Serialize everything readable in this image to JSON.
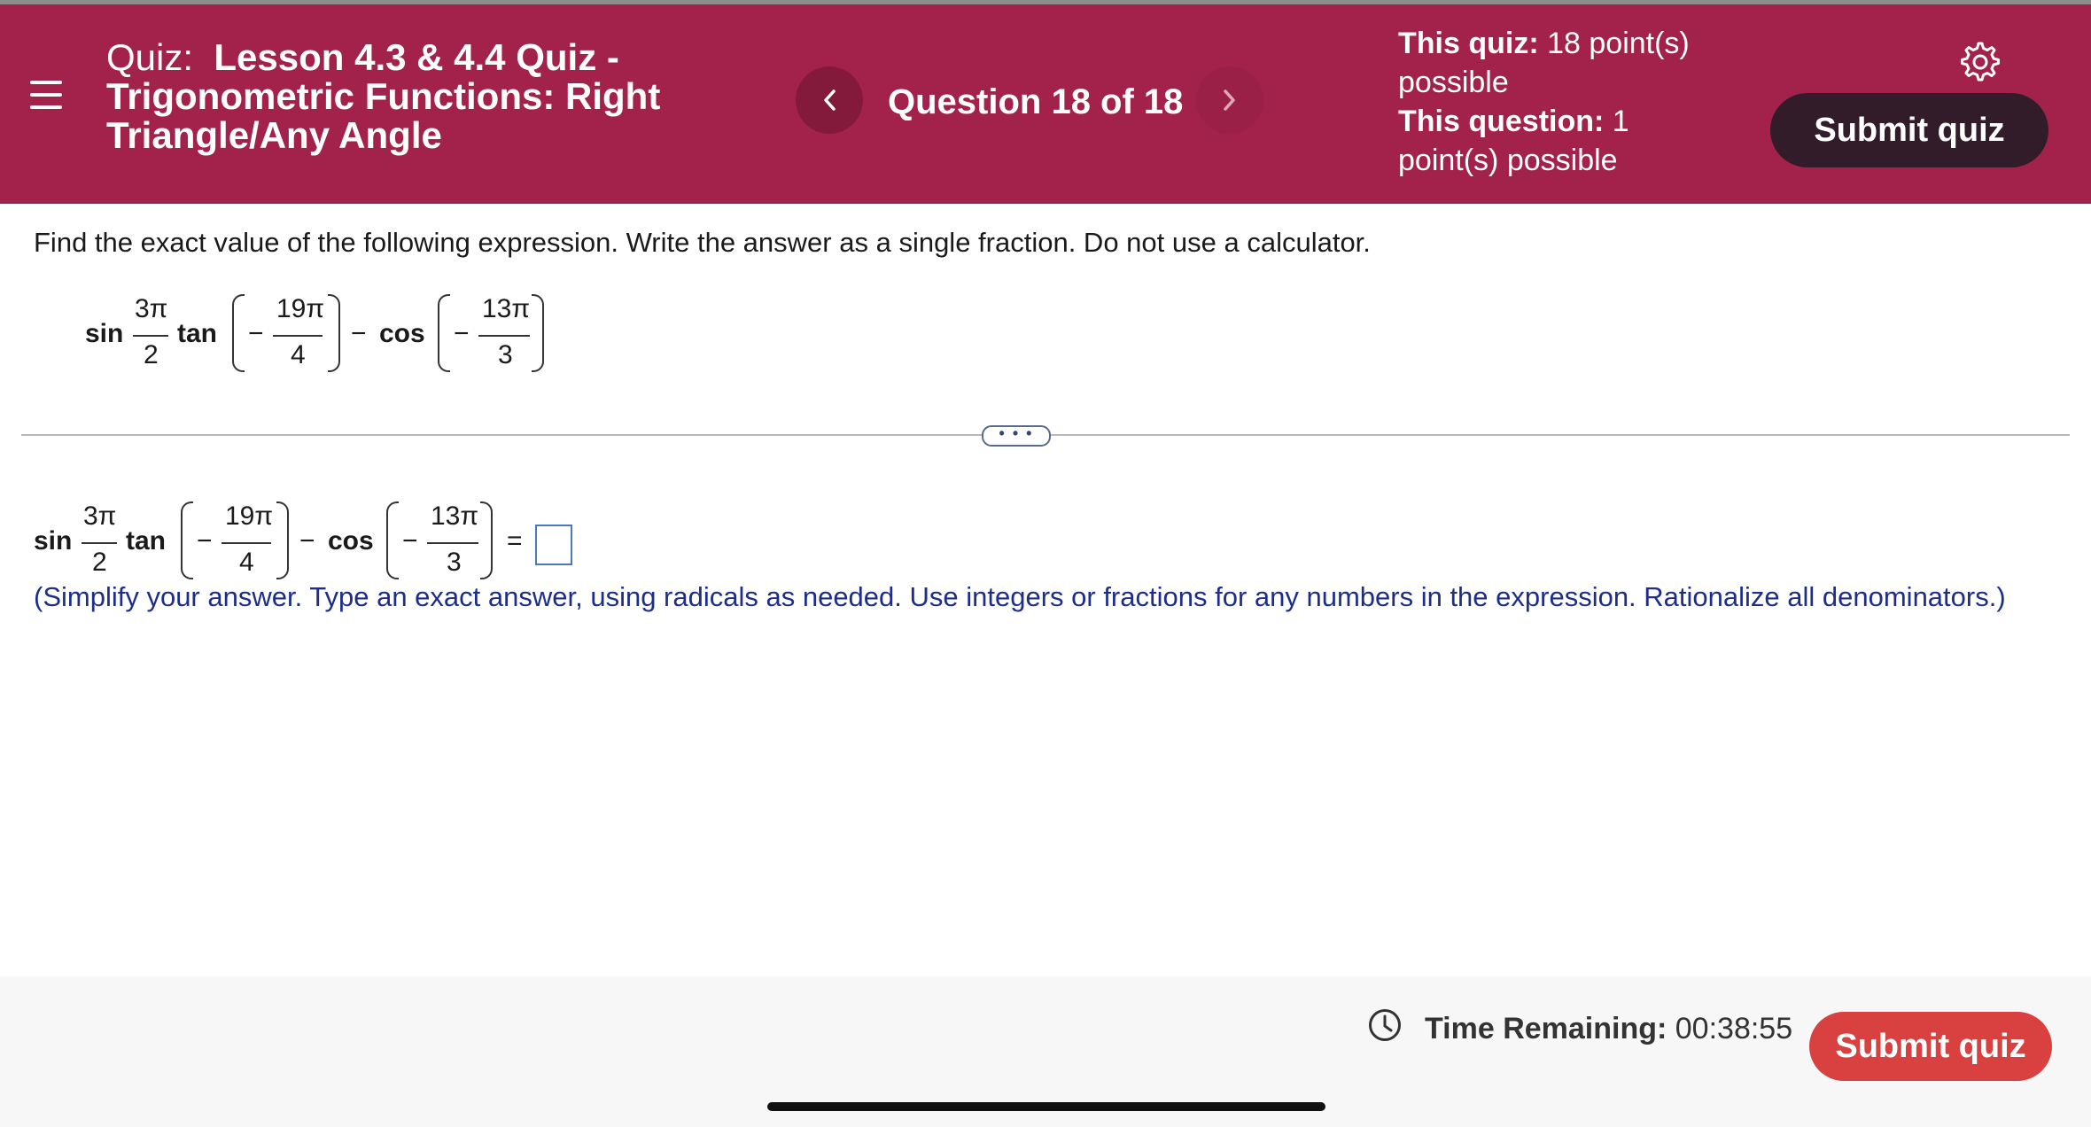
{
  "header": {
    "quiz_prefix": "Quiz:",
    "quiz_name": "Lesson 4.3 & 4.4 Quiz - Trigonometric Functions: Right Triangle/Any Angle",
    "question_counter": "Question 18 of 18",
    "prev_icon": "chevron-left-icon",
    "next_icon": "chevron-right-icon",
    "quiz_points_label": "This quiz:",
    "quiz_points_value": "18 point(s) possible",
    "question_points_label": "This question:",
    "question_points_value": "1 point(s) possible",
    "submit_label": "Submit quiz",
    "colors": {
      "brand": "#a3224b",
      "submit_dark": "#331c2a"
    }
  },
  "question": {
    "instructions": "Find the exact value of the following expression.  Write the answer as a single fraction.  Do not use a calculator.",
    "expression": {
      "fn1": "sin",
      "frac1_num": "3π",
      "frac1_den": "2",
      "fn2": "tan",
      "frac2_num": "19π",
      "frac2_den": "4",
      "fn3": "cos",
      "frac3_num": "13π",
      "frac3_den": "3",
      "minus": "−",
      "equals": "="
    },
    "expand_label": "• • •",
    "hint": "(Simplify your answer.  Type an exact answer, using radicals as needed.  Use integers or fractions for any numbers in the expression.  Rationalize all denominators.)",
    "hint_color": "#1c2e8a"
  },
  "footer": {
    "time_label": "Time Remaining:",
    "time_value": "00:38:55",
    "submit_label": "Submit quiz",
    "clock_icon": "clock-icon",
    "submit_color": "#d94040"
  }
}
